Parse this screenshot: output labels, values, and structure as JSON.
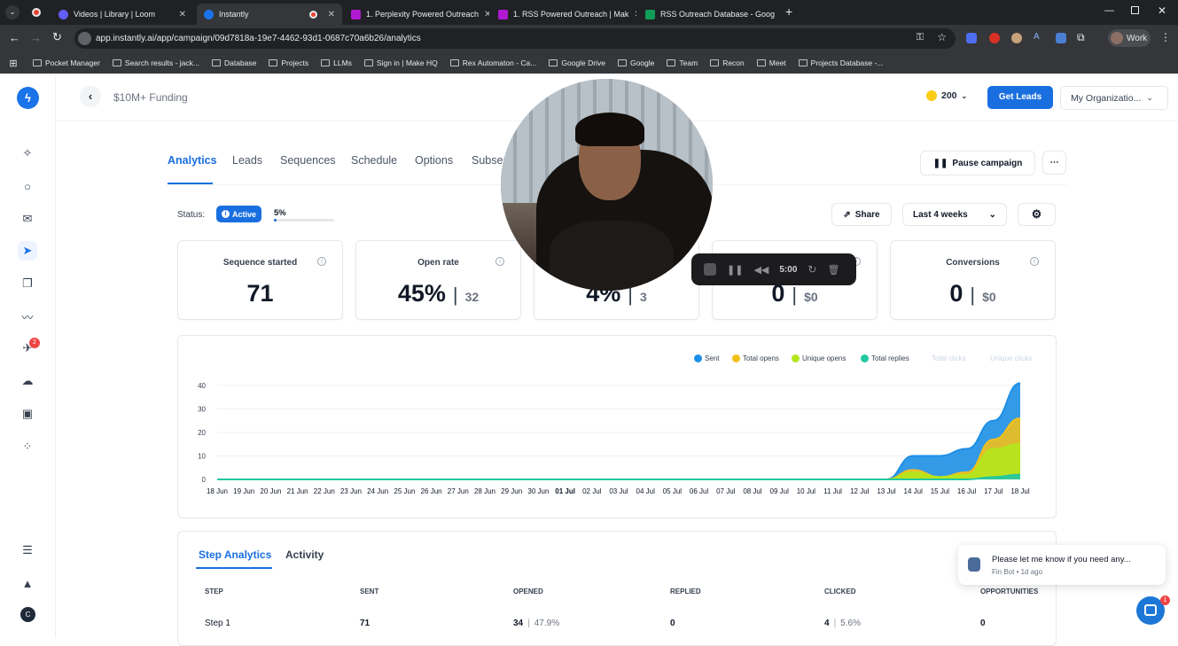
{
  "browser": {
    "tabs": [
      {
        "title": "Videos | Library | Loom",
        "favcolor": "#625df5"
      },
      {
        "title": "Instantly",
        "favcolor": "#1a73e8"
      },
      {
        "title": "1. Perplexity Powered Outreach",
        "favcolor": "#b019d1"
      },
      {
        "title": "1. RSS Powered Outreach | Mak",
        "favcolor": "#b019d1"
      },
      {
        "title": "RSS Outreach Database - Goog",
        "favcolor": "#0f9d58"
      }
    ],
    "url": "app.instantly.ai/app/campaign/09d7818a-19e7-4462-93d1-0687c70a6b26/analytics",
    "profile": "Work",
    "bookmarks": [
      "Pocket Manager",
      "Search results - jack...",
      "Database",
      "Projects",
      "LLMs",
      "Sign in | Make HQ",
      "Rex Automaton - Ca...",
      "Google Drive",
      "Google",
      "Team",
      "Recon",
      "Meet",
      "Projects Database -..."
    ]
  },
  "header": {
    "campaign_name": "$10M+ Funding",
    "credits": "200",
    "get_leads": "Get Leads",
    "org": "My Organizatio..."
  },
  "tabs": [
    "Analytics",
    "Leads",
    "Sequences",
    "Schedule",
    "Options",
    "Subsequ"
  ],
  "actions": {
    "pause": "Pause campaign",
    "share": "Share",
    "range": "Last 4 weeks",
    "more": "⋯"
  },
  "status": {
    "label": "Status:",
    "badge": "Active",
    "progress_text": "5%",
    "progress": 0.05
  },
  "cards": [
    {
      "label": "Sequence started",
      "value": "71",
      "sub": ""
    },
    {
      "label": "Open rate",
      "value": "45%",
      "sub": "32"
    },
    {
      "label": "",
      "value": "4%",
      "sub": "3"
    },
    {
      "label": "",
      "value": "0",
      "sub": "$0"
    },
    {
      "label": "Conversions",
      "value": "0",
      "sub": "$0"
    }
  ],
  "recorder": {
    "time": "5:00"
  },
  "chart_data": {
    "type": "area",
    "legend": [
      {
        "name": "Sent",
        "color": "#1d8fe6"
      },
      {
        "name": "Total opens",
        "color": "#f2c01b"
      },
      {
        "name": "Unique opens",
        "color": "#b5e61d"
      },
      {
        "name": "Total replies",
        "color": "#22c7a0"
      },
      {
        "name": "Total clicks",
        "color": "#cbd5e1"
      },
      {
        "name": "Unique clicks",
        "color": "#e5e7eb"
      }
    ],
    "x": [
      "18 Jun",
      "19 Jun",
      "20 Jun",
      "21 Jun",
      "22 Jun",
      "23 Jun",
      "24 Jun",
      "25 Jun",
      "26 Jun",
      "27 Jun",
      "28 Jun",
      "29 Jun",
      "30 Jun",
      "01 Jul",
      "02 Jul",
      "03 Jul",
      "04 Jul",
      "05 Jul",
      "06 Jul",
      "07 Jul",
      "08 Jul",
      "09 Jul",
      "10 Jul",
      "11 Jul",
      "12 Jul",
      "13 Jul",
      "14 Jul",
      "15 Jul",
      "16 Jul",
      "17 Jul",
      "18 Jul"
    ],
    "bold_ticks": [
      "01 Jul"
    ],
    "yticks": [
      0,
      10,
      20,
      30,
      40
    ],
    "ylim": [
      0,
      40
    ],
    "series": [
      {
        "name": "Sent",
        "color": "#1d8fe6",
        "values": [
          0,
          0,
          0,
          0,
          0,
          0,
          0,
          0,
          0,
          0,
          0,
          0,
          0,
          0,
          0,
          0,
          0,
          0,
          0,
          0,
          0,
          0,
          0,
          0,
          0,
          0,
          10,
          10,
          13,
          25,
          41
        ]
      },
      {
        "name": "Total opens",
        "color": "#f2c01b",
        "values": [
          0,
          0,
          0,
          0,
          0,
          0,
          0,
          0,
          0,
          0,
          0,
          0,
          0,
          0,
          0,
          0,
          0,
          0,
          0,
          0,
          0,
          0,
          0,
          0,
          0,
          0,
          4,
          1,
          3,
          17,
          26
        ]
      },
      {
        "name": "Unique opens",
        "color": "#b5e61d",
        "values": [
          0,
          0,
          0,
          0,
          0,
          0,
          0,
          0,
          0,
          0,
          0,
          0,
          0,
          0,
          0,
          0,
          0,
          0,
          0,
          0,
          0,
          0,
          0,
          0,
          0,
          0,
          3,
          1,
          2,
          13,
          15
        ]
      },
      {
        "name": "Total replies",
        "color": "#22c7a0",
        "values": [
          0,
          0,
          0,
          0,
          0,
          0,
          0,
          0,
          0,
          0,
          0,
          0,
          0,
          0,
          0,
          0,
          0,
          0,
          0,
          0,
          0,
          0,
          0,
          0,
          0,
          0,
          0,
          0,
          0,
          1,
          2
        ]
      }
    ]
  },
  "step_tabs": [
    "Step Analytics",
    "Activity"
  ],
  "table": {
    "headers": [
      "STEP",
      "SENT",
      "OPENED",
      "REPLIED",
      "CLICKED",
      "OPPORTUNITIES"
    ],
    "row": {
      "step": "Step 1",
      "sent": "71",
      "opened": "34",
      "opened_pct": "47.9%",
      "replied": "0",
      "clicked": "4",
      "clicked_pct": "5.6%",
      "opps": "0"
    }
  },
  "chat": {
    "message": "Please let me know if you need any...",
    "meta": "Fin Bot • 1d ago",
    "badge": "1"
  },
  "sidebar_badge": "2",
  "user_initial": "C"
}
